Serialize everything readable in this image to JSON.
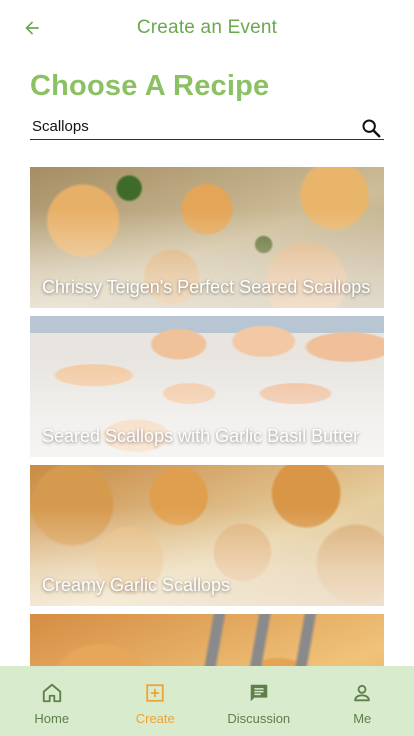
{
  "header": {
    "title": "Create an Event",
    "back_icon": "arrow-back-icon"
  },
  "page": {
    "heading": "Choose A Recipe"
  },
  "search": {
    "value": "Scallops",
    "placeholder": "",
    "icon": "search-icon"
  },
  "recipes": [
    {
      "title": "Chrissy Teigen's Perfect Seared Scallops"
    },
    {
      "title": "Seared Scallops with Garlic Basil Butter"
    },
    {
      "title": "Creamy Garlic Scallops"
    },
    {
      "title": ""
    }
  ],
  "nav": {
    "items": [
      {
        "label": "Home",
        "icon": "home-icon"
      },
      {
        "label": "Create",
        "icon": "add-box-icon",
        "active": true
      },
      {
        "label": "Discussion",
        "icon": "chat-icon"
      },
      {
        "label": "Me",
        "icon": "person-icon"
      }
    ]
  },
  "colors": {
    "primary_green": "#6aa84f",
    "heading_green": "#8bc063",
    "nav_background": "#d9ebcd",
    "nav_text": "#5f7f4b",
    "active_orange": "#f0a430"
  }
}
